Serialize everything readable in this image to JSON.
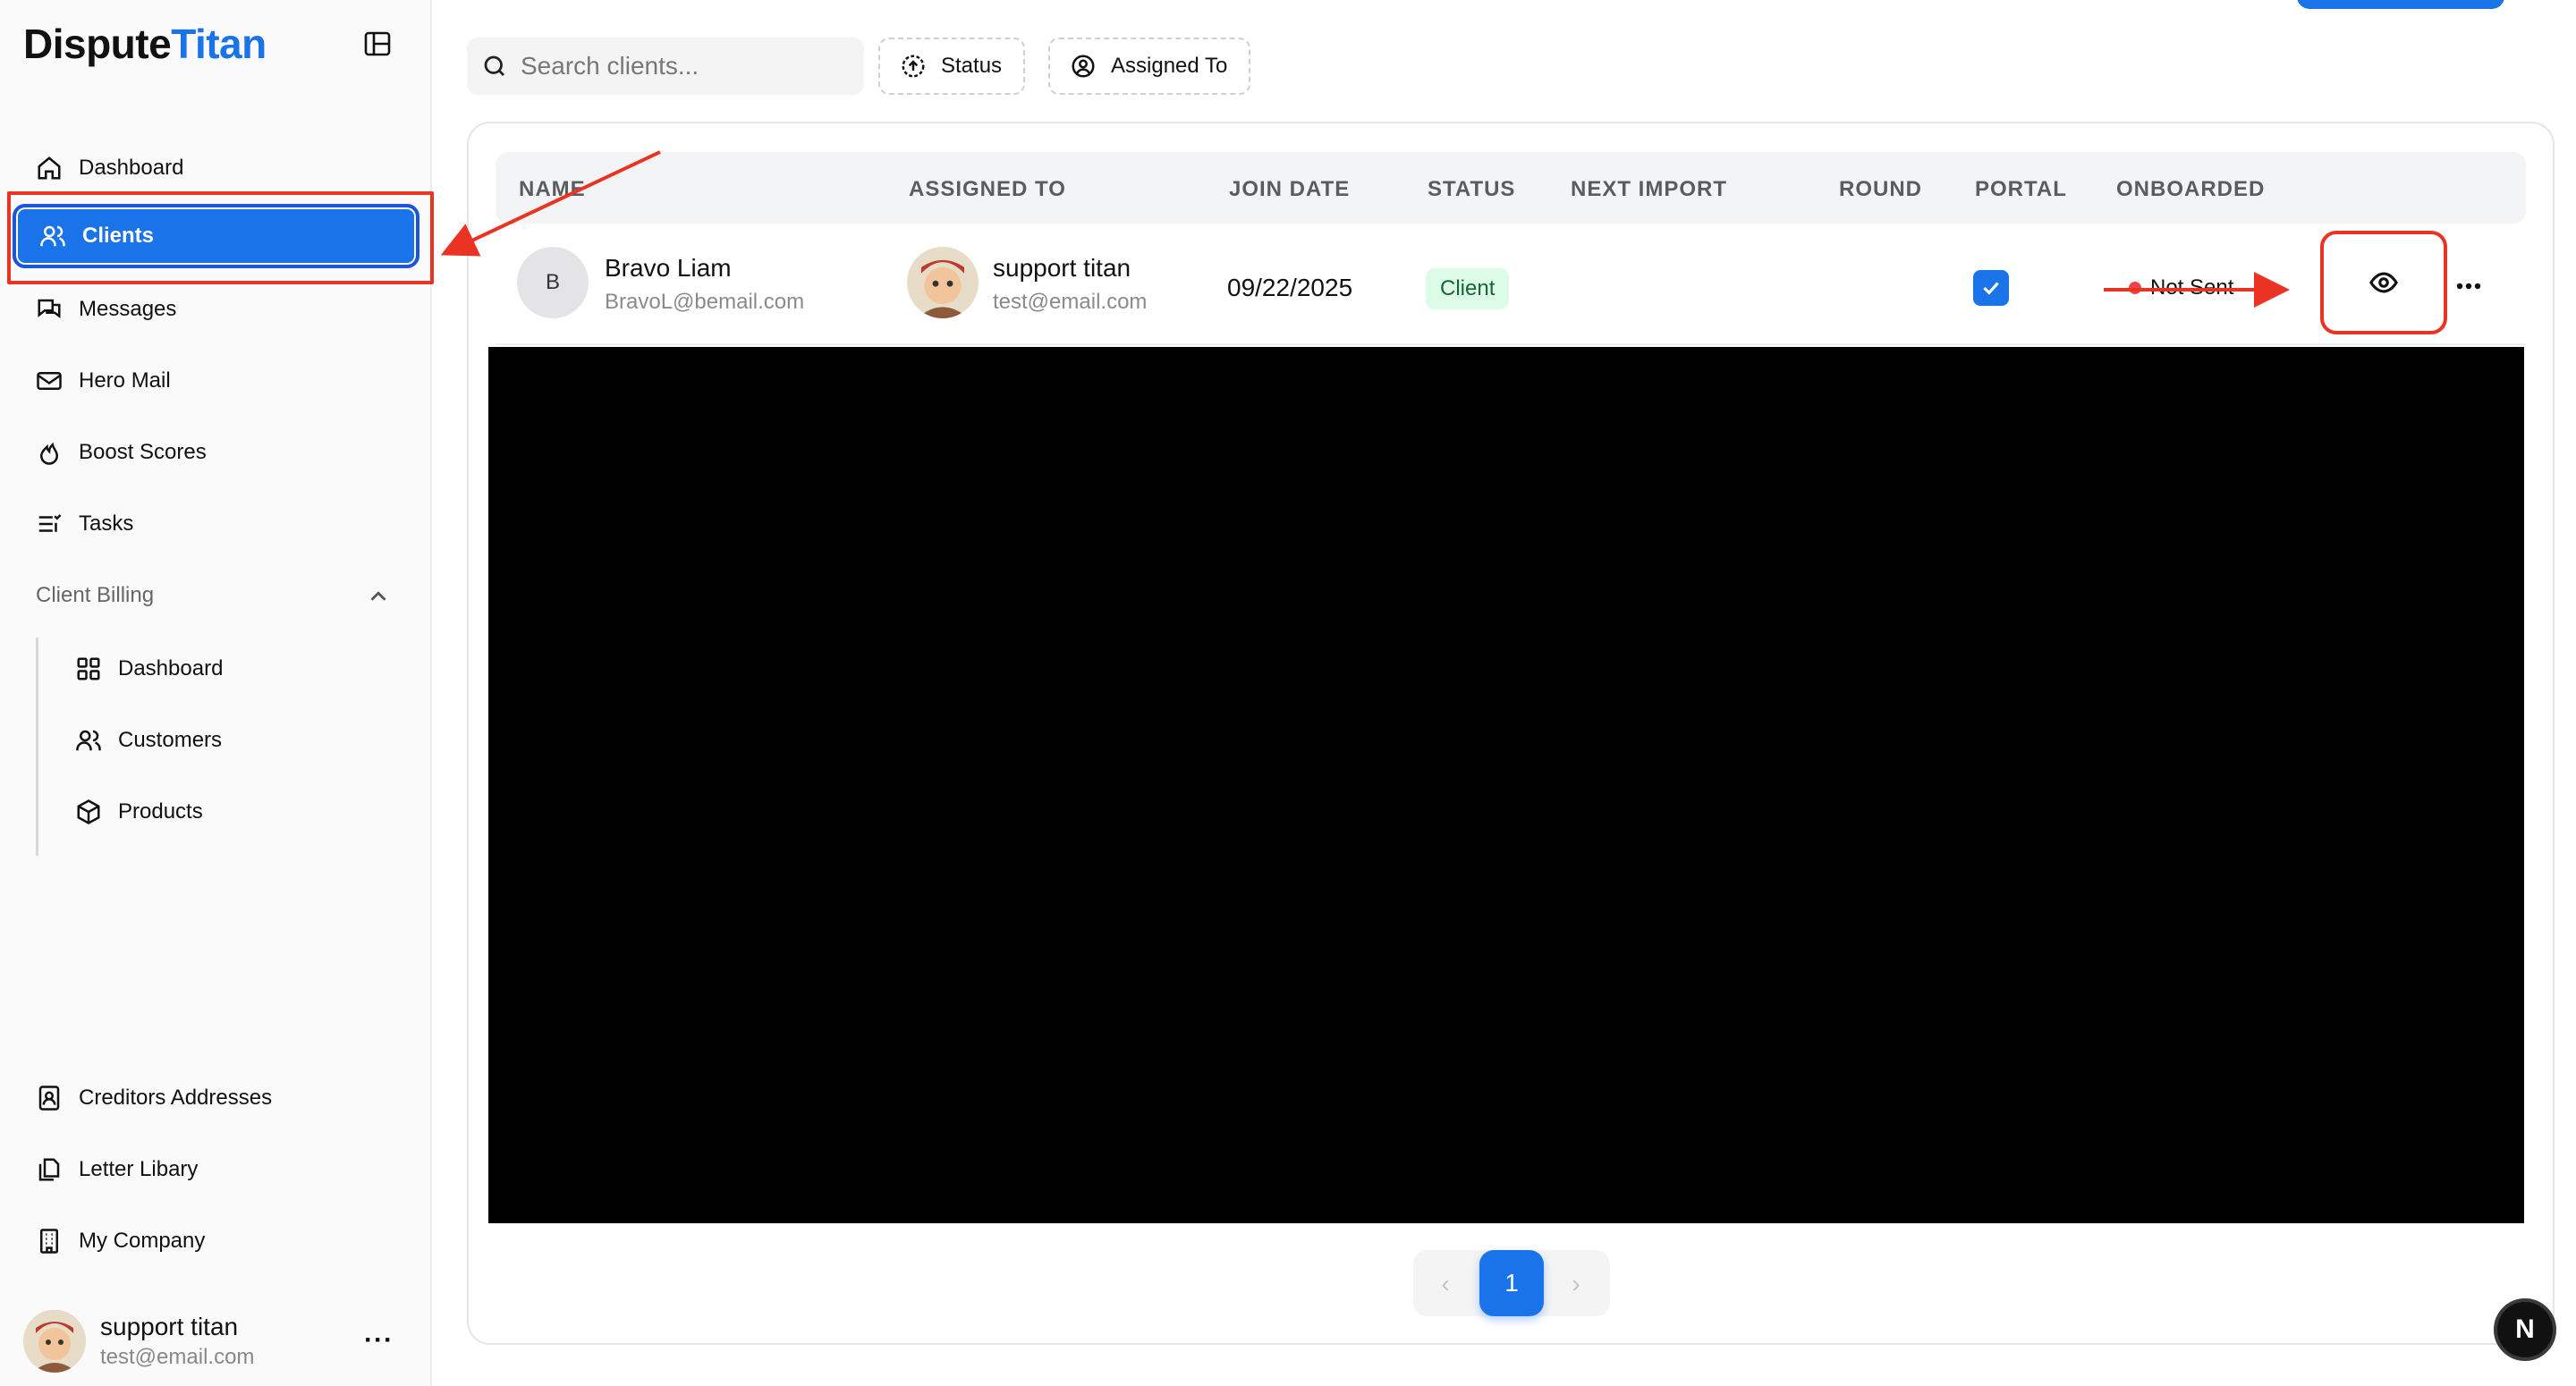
{
  "brand": {
    "part1": "Dispute",
    "part2": "Titan"
  },
  "sidebar": {
    "items": [
      {
        "label": "Dashboard",
        "icon": "home-icon"
      },
      {
        "label": "Clients",
        "icon": "users-icon",
        "active": true
      },
      {
        "label": "Messages",
        "icon": "messages-icon"
      },
      {
        "label": "Hero Mail",
        "icon": "mail-icon"
      },
      {
        "label": "Boost Scores",
        "icon": "flame-icon"
      },
      {
        "label": "Tasks",
        "icon": "tasks-icon"
      }
    ],
    "billing_section": "Client Billing",
    "billing_items": [
      {
        "label": "Dashboard",
        "icon": "grid-icon"
      },
      {
        "label": "Customers",
        "icon": "users-icon"
      },
      {
        "label": "Products",
        "icon": "package-icon"
      }
    ],
    "bottom_items": [
      {
        "label": "Creditors Addresses",
        "icon": "contact-book-icon"
      },
      {
        "label": "Letter Libary",
        "icon": "files-icon"
      },
      {
        "label": "My Company",
        "icon": "building-icon"
      }
    ],
    "user": {
      "name": "support titan",
      "email": "test@email.com",
      "more": "···"
    }
  },
  "toolbar": {
    "search_placeholder": "Search clients...",
    "filter_status": "Status",
    "filter_assigned": "Assigned To"
  },
  "table": {
    "headers": [
      "NAME",
      "ASSIGNED TO",
      "JOIN DATE",
      "STATUS",
      "NEXT IMPORT",
      "ROUND",
      "PORTAL",
      "ONBOARDED"
    ],
    "rows": [
      {
        "initial": "B",
        "name": "Bravo Liam",
        "email": "BravoL@bemail.com",
        "assigned_name": "support titan",
        "assigned_email": "test@email.com",
        "join_date": "09/22/2025",
        "status": "Client",
        "next_import": "",
        "round": "",
        "portal_checked": true,
        "onboarded": "Not Sent"
      }
    ]
  },
  "pagination": {
    "current": "1",
    "prev": "‹",
    "next": "›"
  },
  "fab": {
    "label": "N"
  },
  "colors": {
    "accent": "#1a73e8",
    "annotation": "#ea3323",
    "status_bg": "#dcfce7",
    "status_fg": "#166534"
  }
}
